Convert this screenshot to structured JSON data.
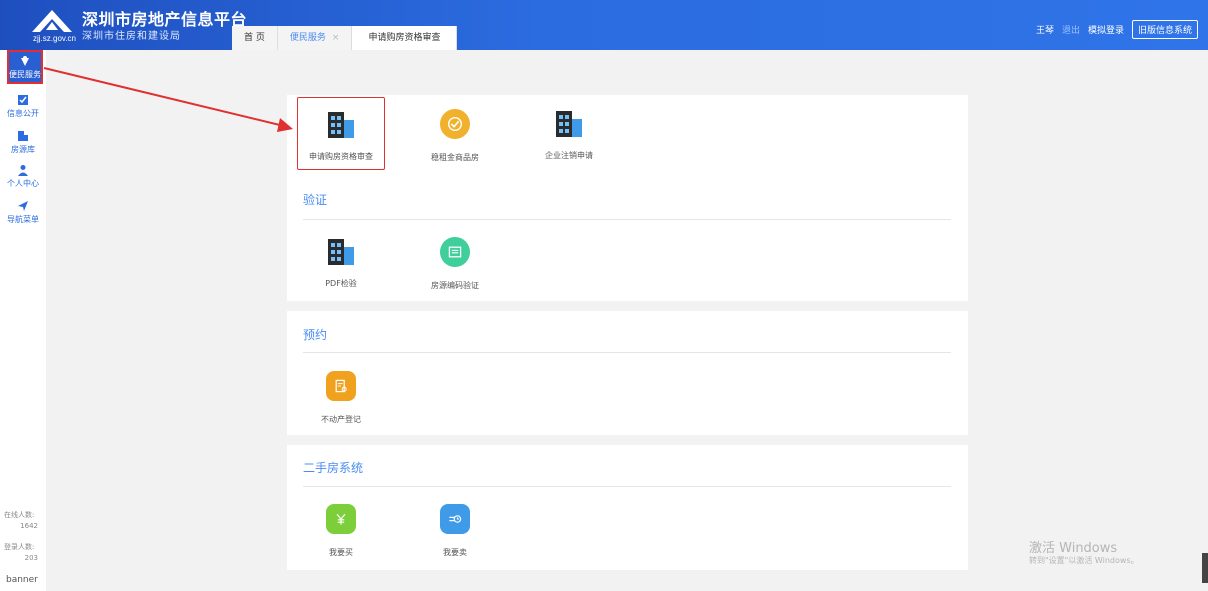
{
  "header": {
    "logo_domain": "zjj.sz.gov.cn",
    "title": "深圳市房地产信息平台",
    "subtitle": "深圳市住房和建设局",
    "tabs": [
      {
        "label": "首 页"
      },
      {
        "label": "便民服务",
        "close": "×"
      },
      {
        "label": "申请购房资格审查"
      }
    ],
    "user": "王琴",
    "logout": "退出",
    "simulate_login": "模拟登录",
    "old_system": "旧版信息系统"
  },
  "sidebar": {
    "items": [
      {
        "label": "便民服务",
        "icon": "service-icon"
      },
      {
        "label": "信息公开",
        "icon": "info-icon"
      },
      {
        "label": "房源库",
        "icon": "building-icon"
      },
      {
        "label": "个人中心",
        "icon": "user-icon"
      },
      {
        "label": "导航菜单",
        "icon": "navigation-icon"
      }
    ],
    "online_label": "在线人数:",
    "online_count": "1642",
    "login_label": "登录人数:",
    "login_count": "203",
    "banner_alt": "banner"
  },
  "panels": {
    "top_services": [
      {
        "label": "申请购房资格审查",
        "icon": "building-icon"
      },
      {
        "label": "稳租金商品房",
        "icon": "check-circle-icon"
      },
      {
        "label": "企业注销申请",
        "icon": "building-icon"
      }
    ],
    "verify": {
      "title": "验证",
      "items": [
        {
          "label": "PDF检验",
          "icon": "building-icon"
        },
        {
          "label": "房源编码验证",
          "icon": "document-icon"
        }
      ]
    },
    "appointment": {
      "title": "预约",
      "items": [
        {
          "label": "不动产登记",
          "icon": "register-icon"
        }
      ]
    },
    "second_hand": {
      "title": "二手房系统",
      "items": [
        {
          "label": "我要买",
          "icon": "yuan-icon"
        },
        {
          "label": "我要卖",
          "icon": "sell-icon"
        }
      ]
    }
  },
  "watermark": {
    "line1": "激活 Windows",
    "line2": "转到\"设置\"以激活 Windows。"
  },
  "colors": {
    "header_blue": "#2b6ce0",
    "accent": "#4a8cf0",
    "highlight": "#e03030"
  }
}
